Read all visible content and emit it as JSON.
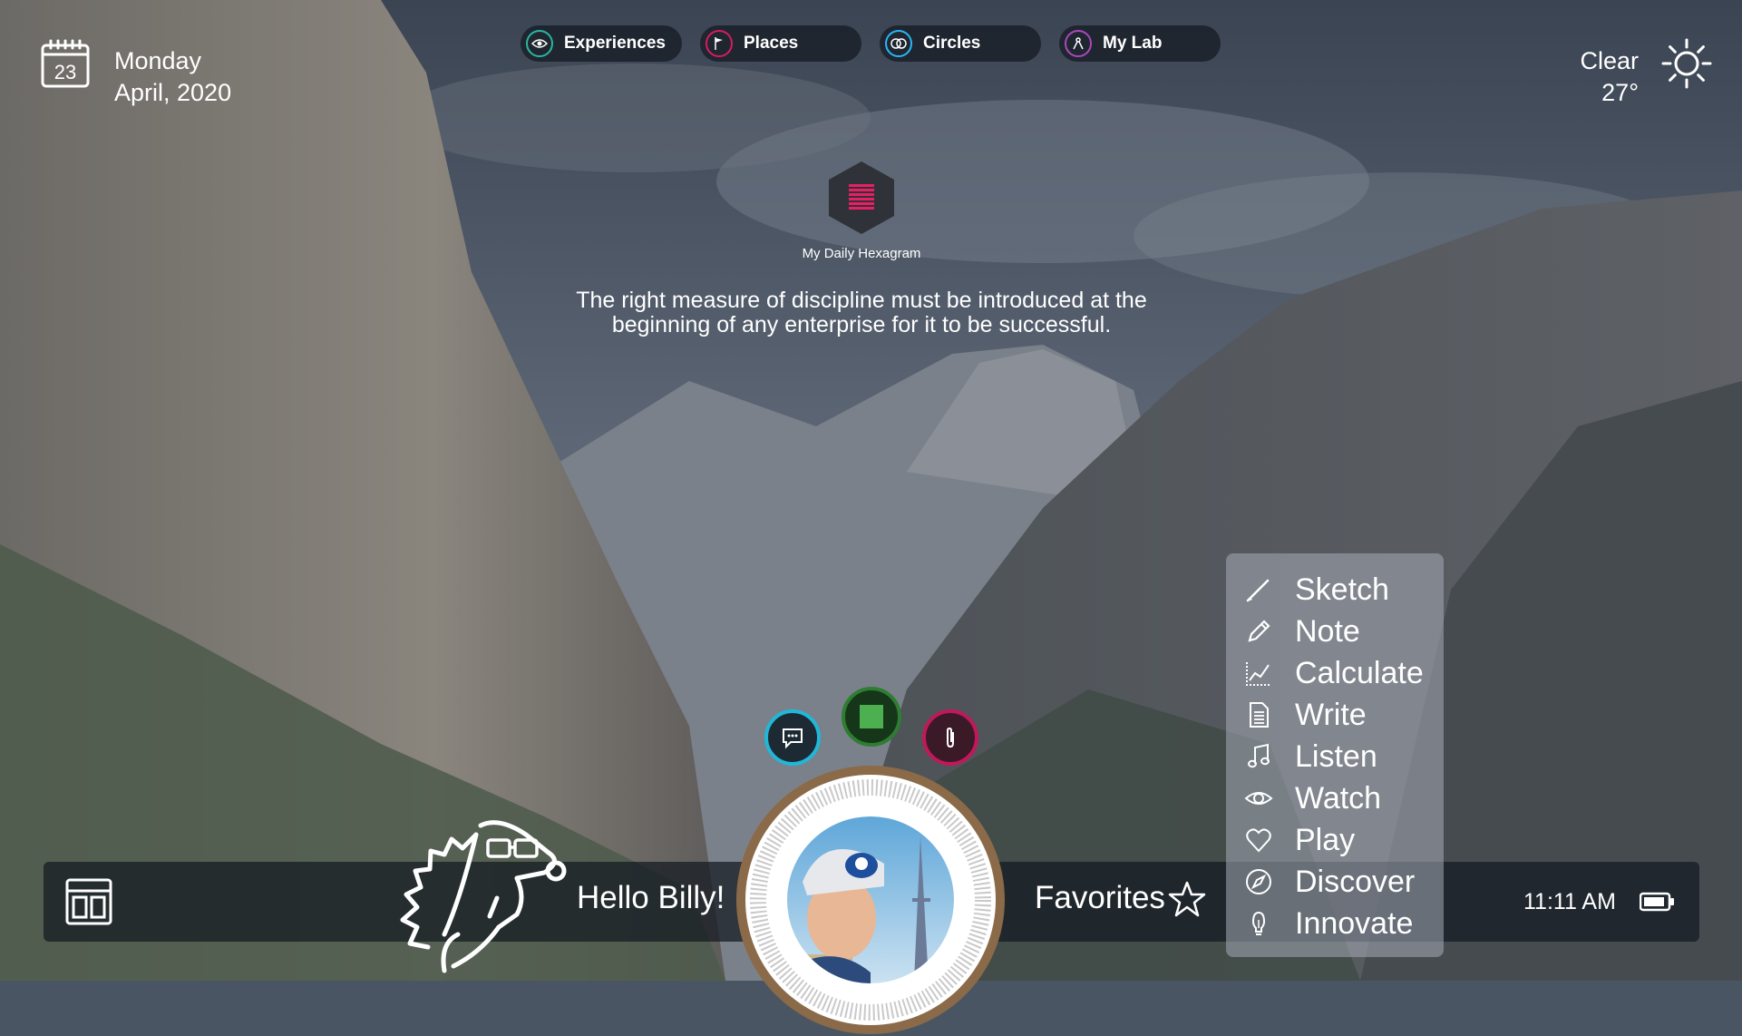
{
  "date": {
    "day_number": "23",
    "weekday": "Monday",
    "month_year": "April, 2020"
  },
  "nav": {
    "tabs": [
      {
        "label": "Experiences",
        "icon": "eye-icon",
        "color": "#2bb5a3"
      },
      {
        "label": "Places",
        "icon": "flag-icon",
        "color": "#d81b60"
      },
      {
        "label": "Circles",
        "icon": "circles-icon",
        "color": "#29b6f6"
      },
      {
        "label": "My Lab",
        "icon": "flask-icon",
        "color": "#ab47bc"
      }
    ]
  },
  "weather": {
    "condition": "Clear",
    "temperature": "27°",
    "icon": "sun-icon"
  },
  "hexagram": {
    "caption": "My Daily Hexagram",
    "color": "#e91e63"
  },
  "quote": {
    "line1": "The right measure of discipline must be introduced at the",
    "line2": "beginning of any enterprise for it to be successful."
  },
  "bottom_bar": {
    "greeting": "Hello Billy!",
    "favorites": "Favorites",
    "time": "11:11 AM"
  },
  "action_buttons": {
    "chat_color": "#1fb8d8",
    "stop_color": "#2e7d32",
    "clip_color": "#c2185b"
  },
  "menu": {
    "items": [
      {
        "label": "Sketch",
        "icon": "brush-icon"
      },
      {
        "label": "Note",
        "icon": "pencil-icon"
      },
      {
        "label": "Calculate",
        "icon": "graph-icon"
      },
      {
        "label": "Write",
        "icon": "document-icon"
      },
      {
        "label": "Listen",
        "icon": "music-note-icon"
      },
      {
        "label": "Watch",
        "icon": "eye-icon"
      },
      {
        "label": "Play",
        "icon": "heart-icon"
      },
      {
        "label": "Discover",
        "icon": "compass-icon"
      },
      {
        "label": "Innovate",
        "icon": "lightbulb-icon"
      }
    ]
  }
}
